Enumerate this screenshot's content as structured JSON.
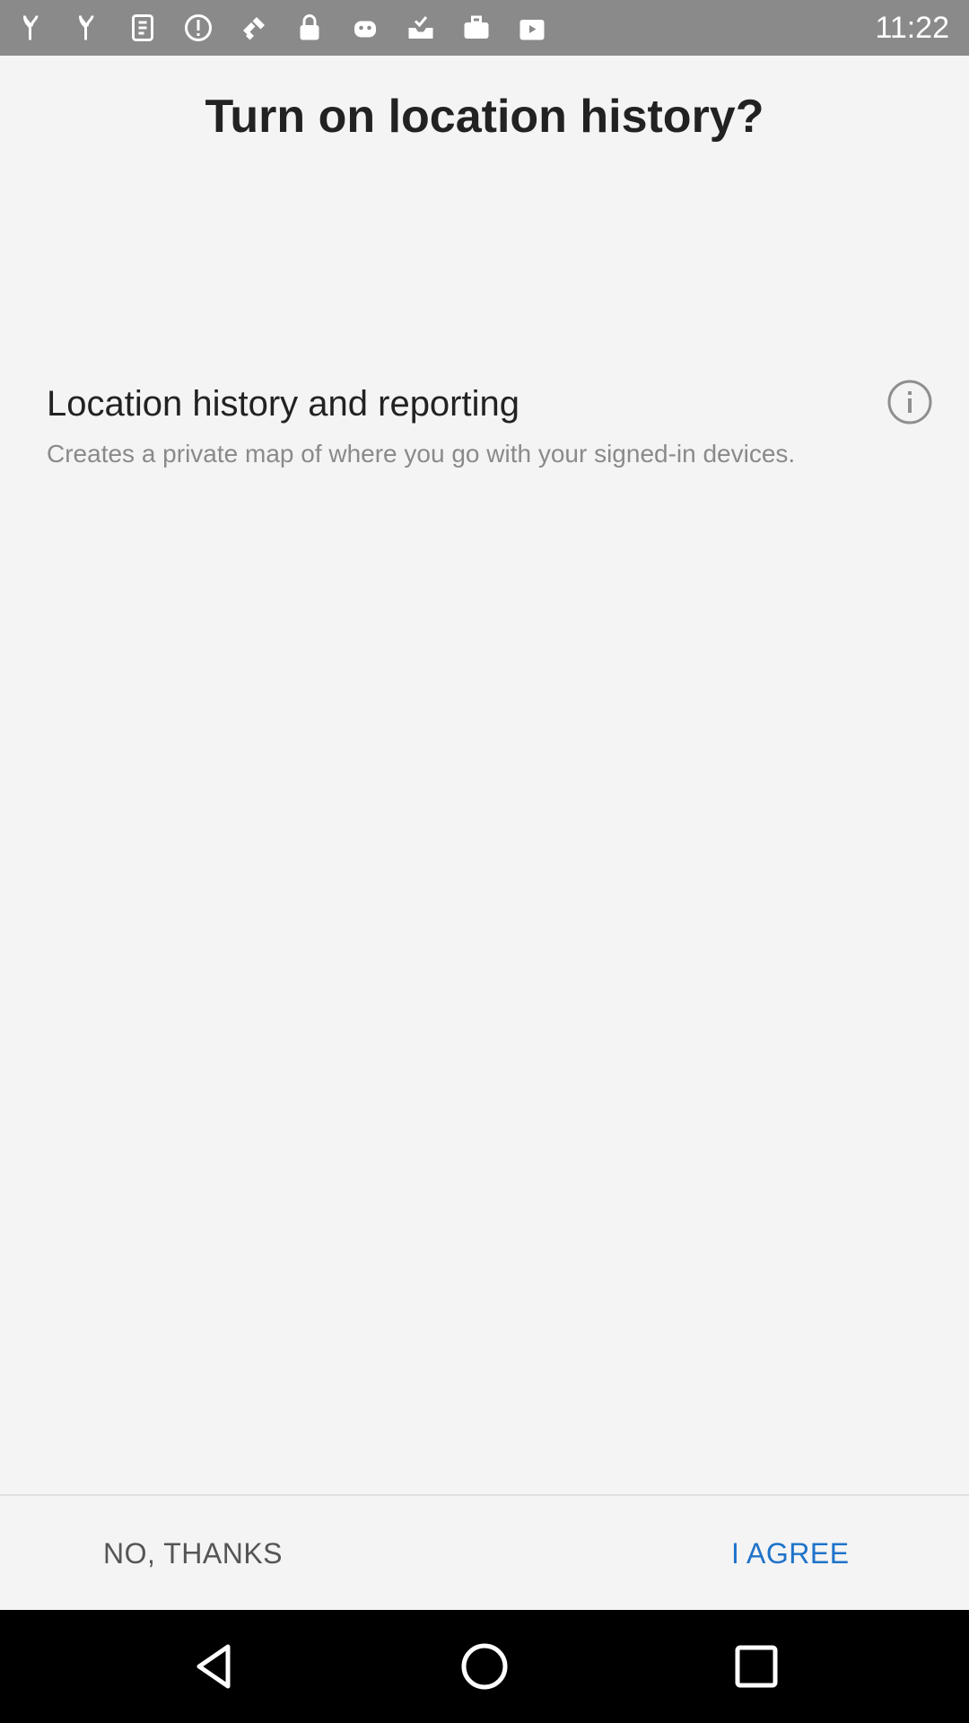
{
  "status_bar": {
    "time": "11:22",
    "icons": [
      "notification-icon",
      "notification-icon",
      "notification-icon",
      "alert-icon",
      "satellite-icon",
      "lock-icon",
      "android-icon",
      "download-done-icon",
      "briefcase-icon",
      "play-store-icon"
    ]
  },
  "dialog": {
    "title": "Turn on location history?",
    "setting": {
      "title": "Location history and reporting",
      "description": "Creates a private map of where you go with your signed-in devices."
    }
  },
  "actions": {
    "decline_label": "NO, THANKS",
    "accept_label": "I AGREE"
  },
  "colors": {
    "accent": "#1f73c9",
    "background": "#f4f4f4",
    "status_bar": "#8a8a8a"
  }
}
